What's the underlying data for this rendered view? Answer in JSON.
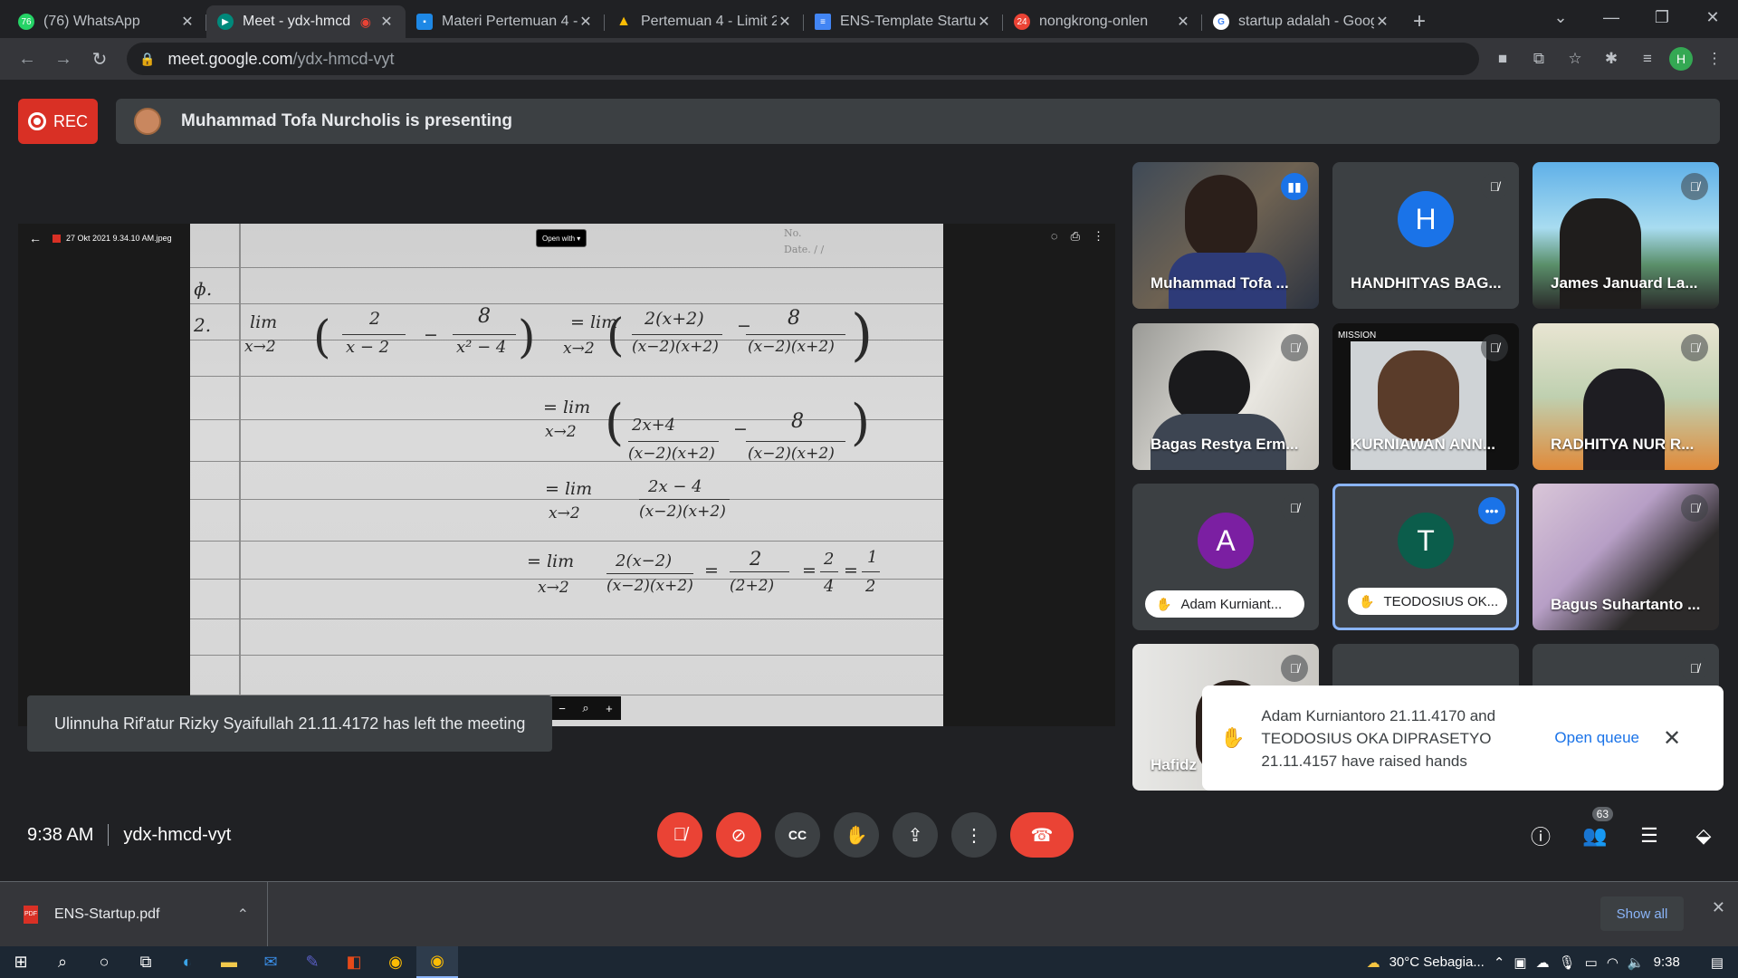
{
  "browser": {
    "tabs": [
      {
        "title": "(76) WhatsApp",
        "icon": "whatsapp-icon",
        "color": "#25d366",
        "badge": "76"
      },
      {
        "title": "Meet - ydx-hmcd",
        "icon": "meet-icon",
        "color": "#00897b",
        "active": true
      },
      {
        "title": "Materi Pertemuan 4 -",
        "icon": "classroom-icon",
        "color": "#1e88e5"
      },
      {
        "title": "Pertemuan 4 - Limit 2",
        "icon": "drive-icon",
        "color": "#fbbc04"
      },
      {
        "title": "ENS-Template Startup",
        "icon": "docs-icon",
        "color": "#4285f4"
      },
      {
        "title": "nongkrong-onlen",
        "icon": "calendar-icon",
        "color": "#ea4335",
        "badge": "24"
      },
      {
        "title": "startup adalah - Goog",
        "icon": "google-icon",
        "color": "#ffffff"
      }
    ],
    "url_host": "meet.google.com",
    "url_path": "/ydx-hmcd-vyt",
    "profile_letter": "H"
  },
  "meet": {
    "rec_label": "REC",
    "presenting": "Muhammad Tofa Nurcholis is presenting",
    "viewer": {
      "file_name": "27 Okt 2021 9.34.10 AM.jpeg",
      "open_with": "Open with"
    },
    "toast": "Ulinnuha Rif'atur Rizky Syaifullah 21.11.4172 has left the meeting",
    "participants": [
      {
        "name": "Muhammad Tofa ...",
        "video": true
      },
      {
        "name": "HANDHITYAS BAG...",
        "letter": "H",
        "color": "#1a73e8"
      },
      {
        "name": "James Januard La...",
        "video": true
      },
      {
        "name": "Bagas Restya Erm...",
        "video": true
      },
      {
        "name": "KURNIAWAN ANN...",
        "video": true
      },
      {
        "name": "RADHITYA NUR R...",
        "video": true
      },
      {
        "name": "Adam Kurniant...",
        "letter": "A",
        "color": "#7b1fa2",
        "hand": true
      },
      {
        "name": "TEODOSIUS OK...",
        "letter": "T",
        "color": "#0b5d4b",
        "hand": true
      },
      {
        "name": "Bagus Suhartanto ...",
        "video": true
      },
      {
        "name": "Hafidz",
        "video": true
      }
    ],
    "notification": {
      "text": "Adam Kurniantoro 21.11.4170 and TEODOSIUS OKA DIPRASETYO 21.11.4157 have raised hands",
      "action": "Open queue"
    },
    "time": "9:38 AM",
    "code": "ydx-hmcd-vyt",
    "people_count": "63"
  },
  "math": {
    "line1": "lim",
    "line2": "x→2"
  },
  "downloads": {
    "file": "ENS-Startup.pdf",
    "show_all": "Show all"
  },
  "taskbar": {
    "weather": "30°C  Sebagia...",
    "clock": "9:38"
  }
}
